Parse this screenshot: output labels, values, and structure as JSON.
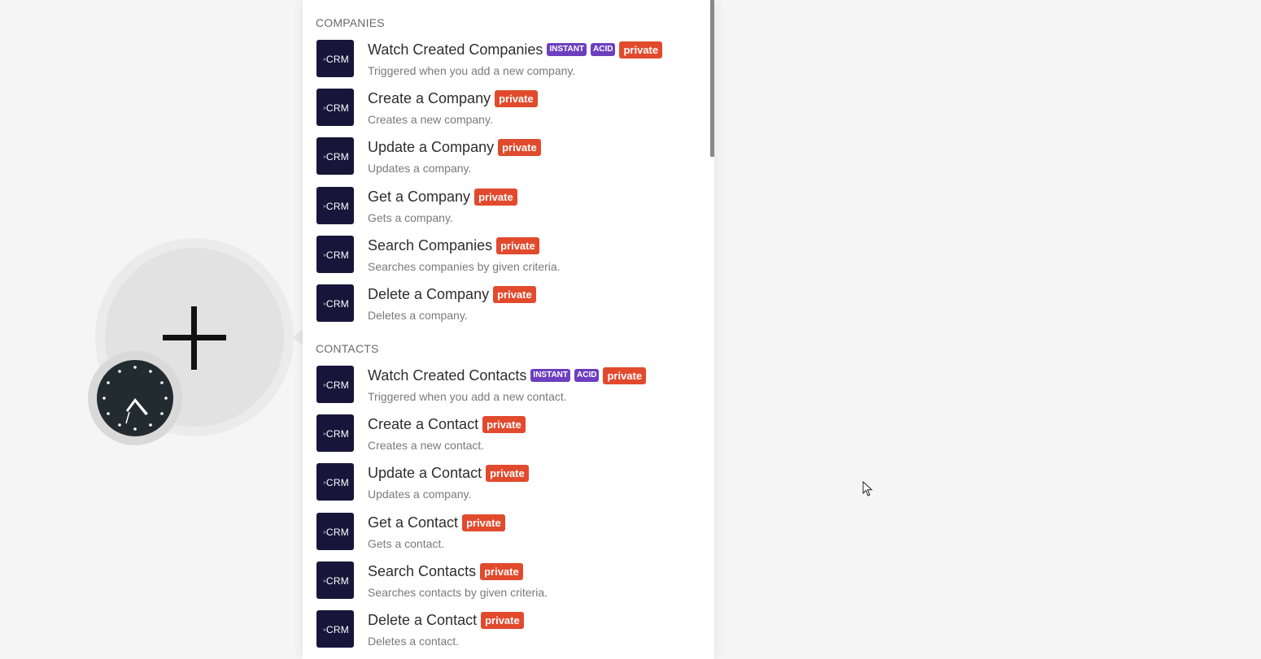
{
  "colors": {
    "badge_instant": "#6c3fbf",
    "badge_private": "#e24a2d",
    "logo_bg": "#17163a",
    "canvas_bg": "#f5f5f5"
  },
  "canvas": {
    "module_icon": "plus-icon",
    "schedule_icon": "clock-icon"
  },
  "logo": {
    "text": "CRM",
    "icon": "crm-app-logo"
  },
  "sections": [
    {
      "title": "COMPANIES",
      "items": [
        {
          "title": "Watch Created Companies",
          "instant": "INSTANT",
          "acid": "ACID",
          "private": "private",
          "desc": "Triggered when you add a new company."
        },
        {
          "title": "Create a Company",
          "private": "private",
          "desc": "Creates a new company."
        },
        {
          "title": "Update a Company",
          "private": "private",
          "desc": "Updates a company."
        },
        {
          "title": "Get a Company",
          "private": "private",
          "desc": "Gets a company."
        },
        {
          "title": "Search Companies",
          "private": "private",
          "desc": "Searches companies by given criteria."
        },
        {
          "title": "Delete a Company",
          "private": "private",
          "desc": "Deletes a company."
        }
      ]
    },
    {
      "title": "CONTACTS",
      "items": [
        {
          "title": "Watch Created Contacts",
          "instant": "INSTANT",
          "acid": "ACID",
          "private": "private",
          "desc": "Triggered when you add a new contact."
        },
        {
          "title": "Create a Contact",
          "private": "private",
          "desc": "Creates a new contact."
        },
        {
          "title": "Update a Contact",
          "private": "private",
          "desc": "Updates a company."
        },
        {
          "title": "Get a Contact",
          "private": "private",
          "desc": "Gets a contact."
        },
        {
          "title": "Search Contacts",
          "private": "private",
          "desc": "Searches contacts by given criteria."
        },
        {
          "title": "Delete a Contact",
          "private": "private",
          "desc": "Deletes a contact."
        }
      ]
    }
  ]
}
